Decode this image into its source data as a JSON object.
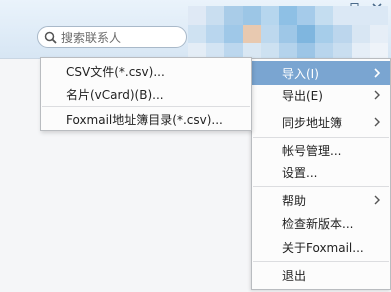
{
  "search": {
    "placeholder": "搜索联系人"
  },
  "main_menu": {
    "items": [
      {
        "label": "导入(I)",
        "has_submenu": true
      },
      {
        "label": "导出(E)",
        "has_submenu": true
      },
      {
        "label": "同步地址簿",
        "has_submenu": true
      },
      {
        "label": "帐号管理..."
      },
      {
        "label": "设置..."
      },
      {
        "label": "帮助",
        "has_submenu": true
      },
      {
        "label": "检查新版本..."
      },
      {
        "label": "关于Foxmail..."
      },
      {
        "label": "退出"
      }
    ]
  },
  "import_submenu": {
    "items": [
      {
        "label": "CSV文件(*.csv)..."
      },
      {
        "label": "名片(vCard)(B)..."
      },
      {
        "label": "Foxmail地址簿目录(*.csv)..."
      }
    ]
  },
  "colors": {
    "highlight": "#7aa5d1",
    "header": "#dbe8f5"
  }
}
